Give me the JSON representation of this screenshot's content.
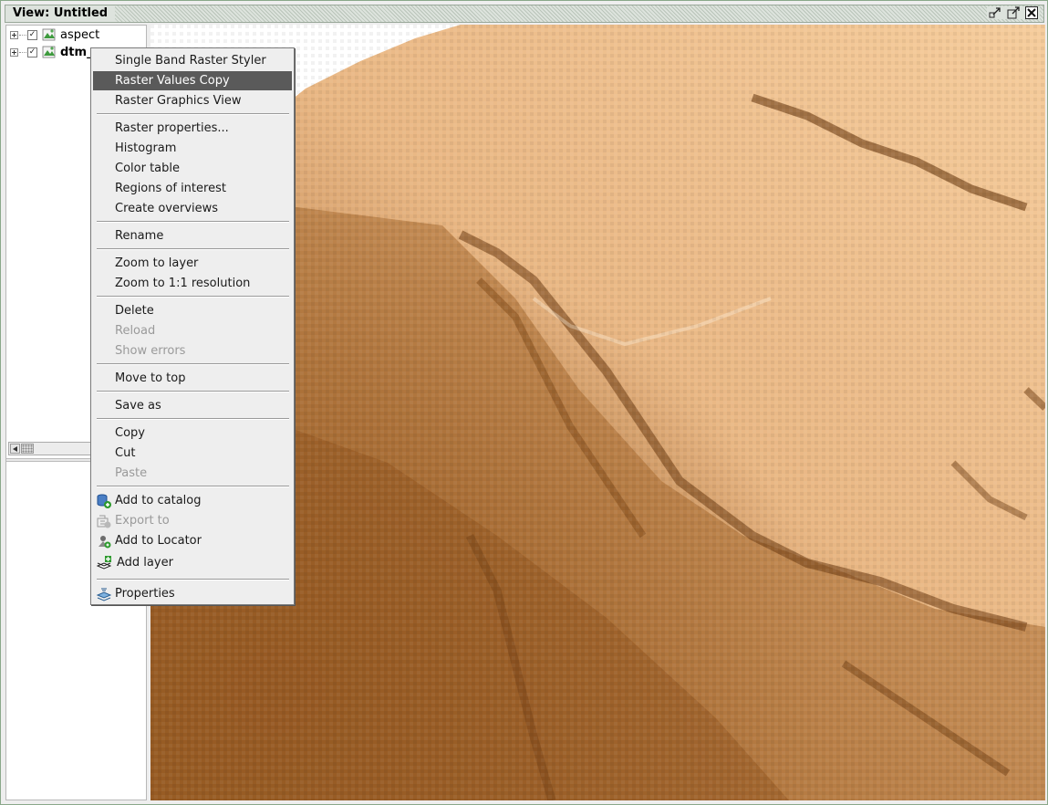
{
  "window": {
    "title": "View: Untitled",
    "buttons": [
      "restore-icon",
      "maximize-icon",
      "close-icon"
    ]
  },
  "toc": {
    "layers": [
      {
        "label": "aspect",
        "checked": true,
        "bold": false
      },
      {
        "label": "dtm_..",
        "checked": true,
        "bold": true
      }
    ]
  },
  "context_menu": {
    "groups": [
      [
        "Single Band Raster Styler",
        "Raster Values Copy",
        "Raster Graphics View"
      ],
      [
        "Raster properties...",
        "Histogram",
        "Color table",
        "Regions of interest",
        "Create overviews"
      ],
      [
        "Rename"
      ],
      [
        "Zoom to layer",
        "Zoom to 1:1 resolution"
      ],
      [
        "Delete",
        "Reload",
        "Show errors"
      ],
      [
        "Move to top"
      ],
      [
        "Save as"
      ],
      [
        "Copy",
        "Cut",
        "Paste"
      ],
      [
        "Add to catalog",
        "Export to",
        "Add to Locator",
        "Add layer"
      ],
      [
        "Properties"
      ]
    ],
    "selected": "Raster Values Copy",
    "disabled": [
      "Reload",
      "Show errors",
      "Paste",
      "Export to"
    ],
    "icons": {
      "Add to catalog": "database-add-icon",
      "Export to": "export-icon",
      "Add to Locator": "locator-icon",
      "Add layer": "add-layer-icon",
      "Properties": "properties-icon"
    }
  },
  "colors": {
    "menu_selection": "#5a5a5a",
    "raster_dark": "#6b3a10",
    "raster_light": "#f7cc9a"
  }
}
